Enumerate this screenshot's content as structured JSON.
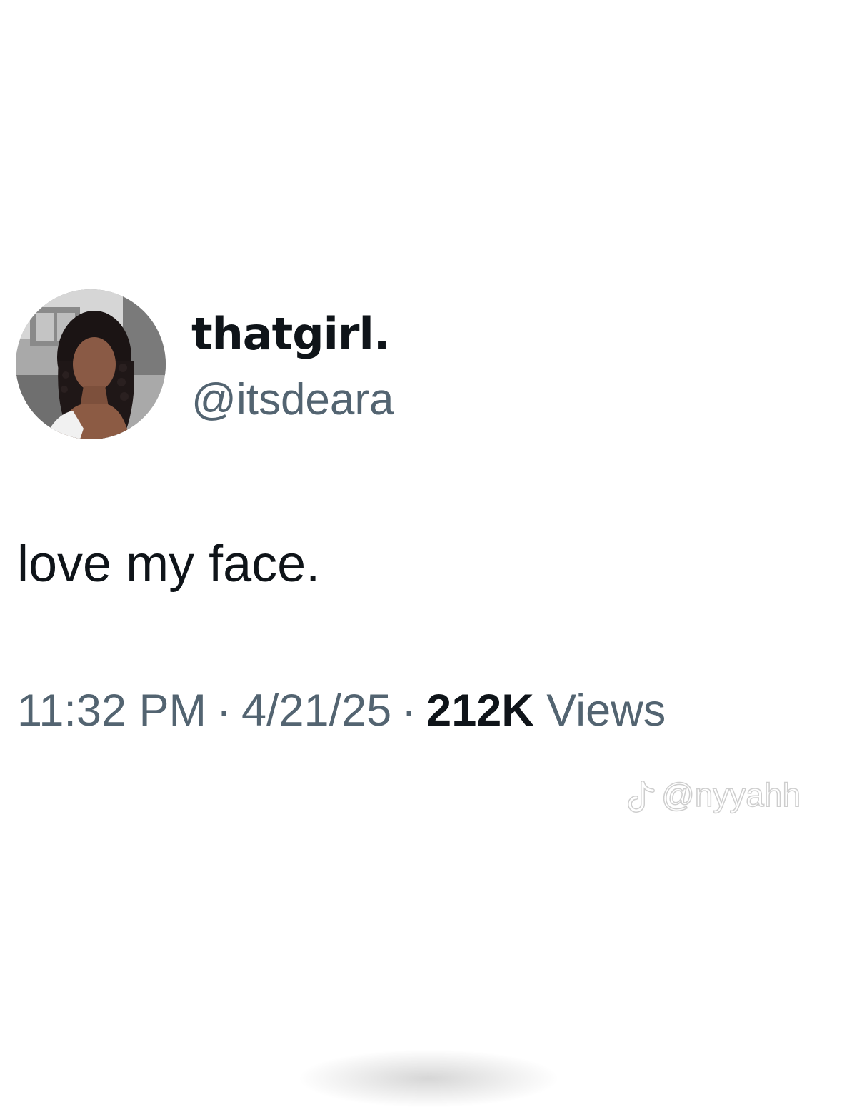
{
  "tweet": {
    "display_name": "thatgirl.",
    "handle": "@itsdeara",
    "text": "love my face.",
    "time": "11:32 PM",
    "separator": "·",
    "date": "4/21/25",
    "views_count": "212K",
    "views_label": "Views"
  },
  "watermark": {
    "icon": "tiktok-logo-icon",
    "username": "@nyyahh"
  },
  "colors": {
    "text_primary": "#0f1419",
    "text_secondary": "#536471",
    "background": "#ffffff"
  }
}
